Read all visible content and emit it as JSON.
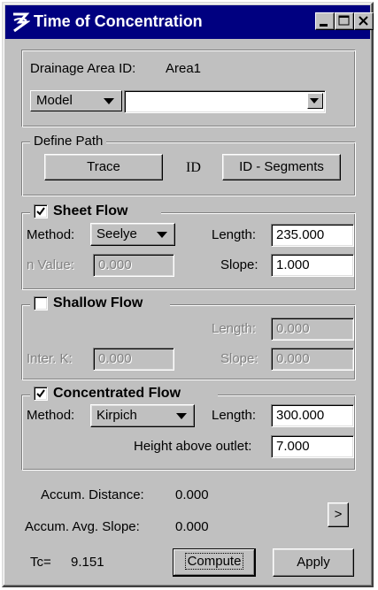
{
  "window": {
    "title": "Time of Concentration",
    "icon": "drainage-app-icon",
    "controls": [
      "minimize-icon",
      "maximize-icon",
      "close-icon"
    ]
  },
  "area": {
    "id_label": "Drainage Area ID:",
    "id_value": "Area1",
    "source_selected": "Model",
    "model_selected": ""
  },
  "define_path": {
    "legend": "Define Path",
    "trace_label": "Trace",
    "id_icon_label": "ID",
    "id_segments_label": "ID - Segments"
  },
  "sheet_flow": {
    "legend": "Sheet Flow",
    "checked": true,
    "method_label": "Method:",
    "method_value": "Seelye",
    "n_value_label": "n Value:",
    "n_value": "0.000",
    "length_label": "Length:",
    "length_value": "235.000",
    "slope_label": "Slope:",
    "slope_value": "1.000"
  },
  "shallow_flow": {
    "legend": "Shallow Flow",
    "checked": false,
    "inter_k_label": "Inter. K:",
    "inter_k_value": "0.000",
    "length_label": "Length:",
    "length_value": "0.000",
    "slope_label": "Slope:",
    "slope_value": "0.000"
  },
  "concentrated_flow": {
    "legend": "Concentrated Flow",
    "checked": true,
    "method_label": "Method:",
    "method_value": "Kirpich",
    "length_label": "Length:",
    "length_value": "300.000",
    "height_label": "Height above outlet:",
    "height_value": "7.000"
  },
  "results": {
    "distance_label": "Accum. Distance:",
    "distance_value": "0.000",
    "slope_label": "Accum. Avg. Slope:",
    "slope_value": "0.000",
    "tc_label": "Tc=",
    "tc_value": "9.151",
    "more_label": ">",
    "compute_label": "Compute",
    "apply_label": "Apply"
  }
}
